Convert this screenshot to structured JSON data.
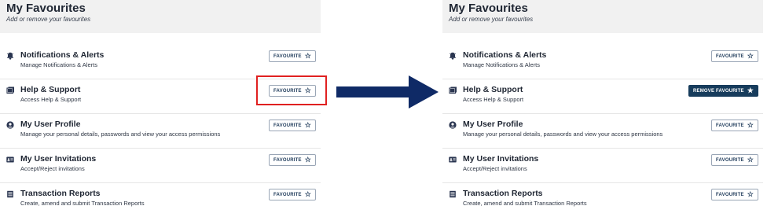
{
  "before": {
    "title": "My Favourites",
    "subtitle": "Add or remove your favourites",
    "items": [
      {
        "icon": "bell-icon",
        "title": "Notifications & Alerts",
        "desc": "Manage Notifications & Alerts",
        "button": "FAVOURITE"
      },
      {
        "icon": "book-icon",
        "title": "Help & Support",
        "desc": "Access Help & Support",
        "button": "FAVOURITE"
      },
      {
        "icon": "user-circle-icon",
        "title": "My User Profile",
        "desc": "Manage your personal details, passwords and view your access permissions",
        "button": "FAVOURITE"
      },
      {
        "icon": "id-card-icon",
        "title": "My User Invitations",
        "desc": "Accept/Reject invitations",
        "button": "FAVOURITE"
      },
      {
        "icon": "report-icon",
        "title": "Transaction Reports",
        "desc": "Create, amend and submit Transaction Reports",
        "button": "FAVOURITE"
      }
    ]
  },
  "after": {
    "title": "My Favourites",
    "subtitle": "Add or remove your favourites",
    "items": [
      {
        "icon": "bell-icon",
        "title": "Notifications & Alerts",
        "desc": "Manage Notifications & Alerts",
        "button": "FAVOURITE"
      },
      {
        "icon": "book-icon",
        "title": "Help & Support",
        "desc": "Access Help & Support",
        "button": "REMOVE FAVOURITE"
      },
      {
        "icon": "user-circle-icon",
        "title": "My User Profile",
        "desc": "Manage your personal details, passwords and view your access permissions",
        "button": "FAVOURITE"
      },
      {
        "icon": "id-card-icon",
        "title": "My User Invitations",
        "desc": "Accept/Reject invitations",
        "button": "FAVOURITE"
      },
      {
        "icon": "report-icon",
        "title": "Transaction Reports",
        "desc": "Create, amend and submit Transaction Reports",
        "button": "FAVOURITE"
      }
    ]
  },
  "colors": {
    "highlight": "#e02020",
    "arrow": "#0f2a66",
    "active_button": "#173c5c"
  }
}
